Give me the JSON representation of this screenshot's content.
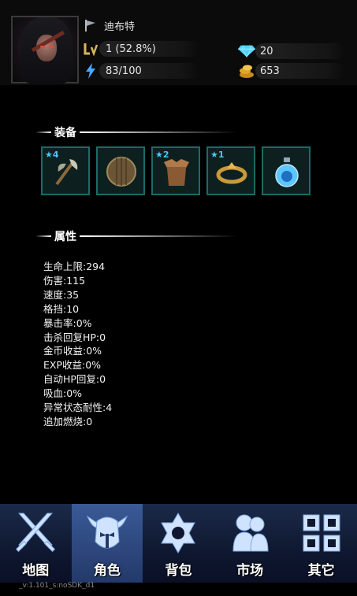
{
  "header": {
    "name": "迪布特",
    "level": "1 (52.8%)",
    "energy": "83/100",
    "gems": "20",
    "gold": "653"
  },
  "equipment": {
    "title": "装备",
    "slots": [
      {
        "stars": "★4",
        "item": "axe-icon"
      },
      {
        "stars": "",
        "item": "shield-icon"
      },
      {
        "stars": "★2",
        "item": "armor-icon"
      },
      {
        "stars": "★1",
        "item": "ring-icon"
      },
      {
        "stars": "",
        "item": "potion-icon"
      }
    ]
  },
  "attributes": {
    "title": "属性",
    "items": [
      "生命上限:294",
      "伤害:115",
      "速度:35",
      "格挡:10",
      "暴击率:0%",
      "击杀回复HP:0",
      "金币收益:0%",
      "EXP收益:0%",
      "自动HP回复:0",
      "吸血:0%",
      "异常状态耐性:4",
      "追加燃烧:0"
    ]
  },
  "nav": {
    "items": [
      {
        "label": "地图",
        "icon": "crossed-swords-icon"
      },
      {
        "label": "角色",
        "icon": "helmet-icon"
      },
      {
        "label": "背包",
        "icon": "star-icon"
      },
      {
        "label": "市场",
        "icon": "people-icon"
      },
      {
        "label": "其它",
        "icon": "grid-icon"
      }
    ],
    "active": "角色"
  },
  "version": "_v:1.101_s:noSDK_d1",
  "colors": {
    "slot_border": "#1a6b66",
    "star": "#47c6ff",
    "nav_bg": "#1b2a4a",
    "nav_active": "#3a5a96"
  }
}
